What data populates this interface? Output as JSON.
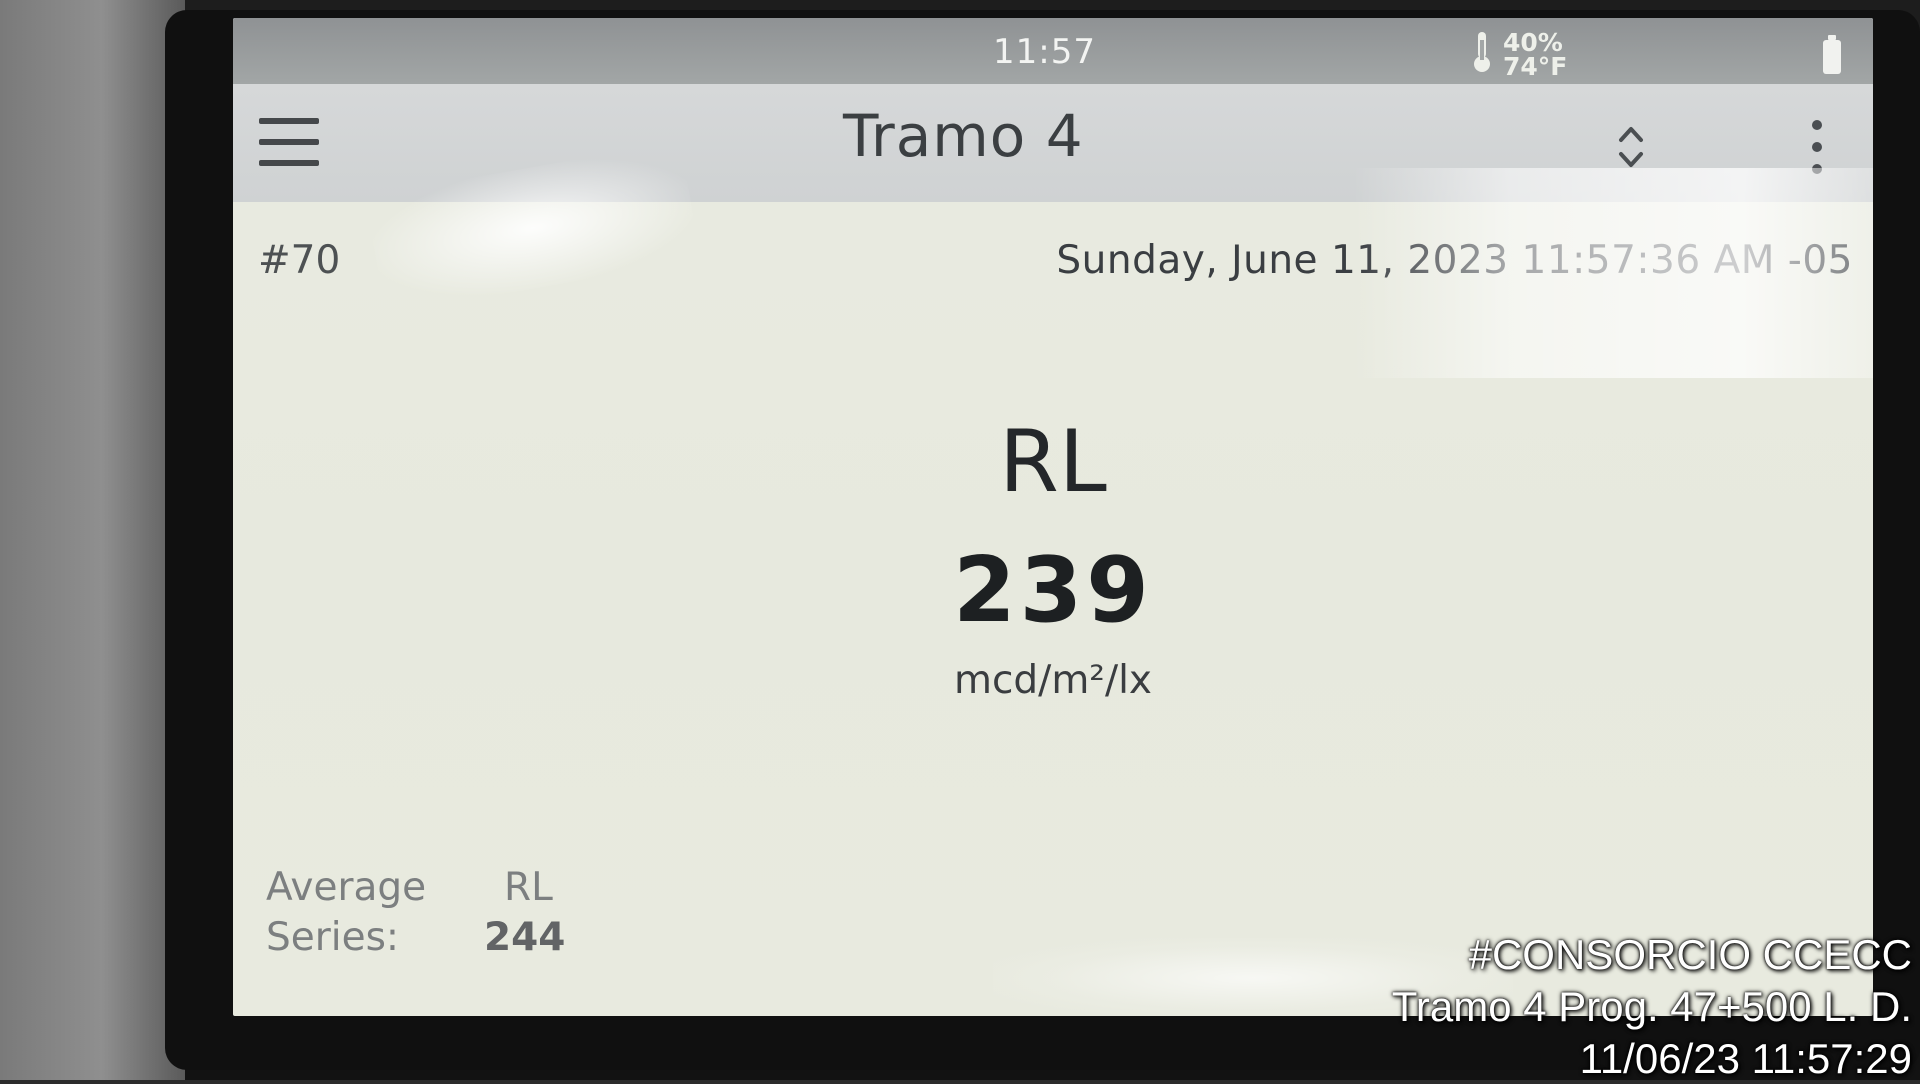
{
  "status_bar": {
    "time": "11:57",
    "humidity": "40%",
    "temperature": "74°F"
  },
  "app_bar": {
    "title": "Tramo 4",
    "menu_icon": "hamburger-menu-icon",
    "sort_icon": "up-down-chevron-icon",
    "more_icon": "vertical-ellipsis-icon"
  },
  "reading": {
    "record_id": "#70",
    "datetime": "Sunday, June 11, 2023 11:57:36 AM -05",
    "metric_label": "RL",
    "value": "239",
    "unit": "mcd/m²/lx",
    "average": {
      "label_line_1": "Average",
      "label_line_2": "Series:",
      "metric": "RL",
      "value": "244"
    }
  },
  "overlay": {
    "line1": "#CONSORCIO CCECC",
    "line2": "Tramo 4 Prog. 47+500 L. D.",
    "line3": "11/06/23  11:57:29"
  },
  "colors": {
    "screen_background": "#e8eadf",
    "status_bar": "#9a9d9e",
    "app_bar": "#d2d5d6",
    "primary_text": "#1d2022"
  }
}
